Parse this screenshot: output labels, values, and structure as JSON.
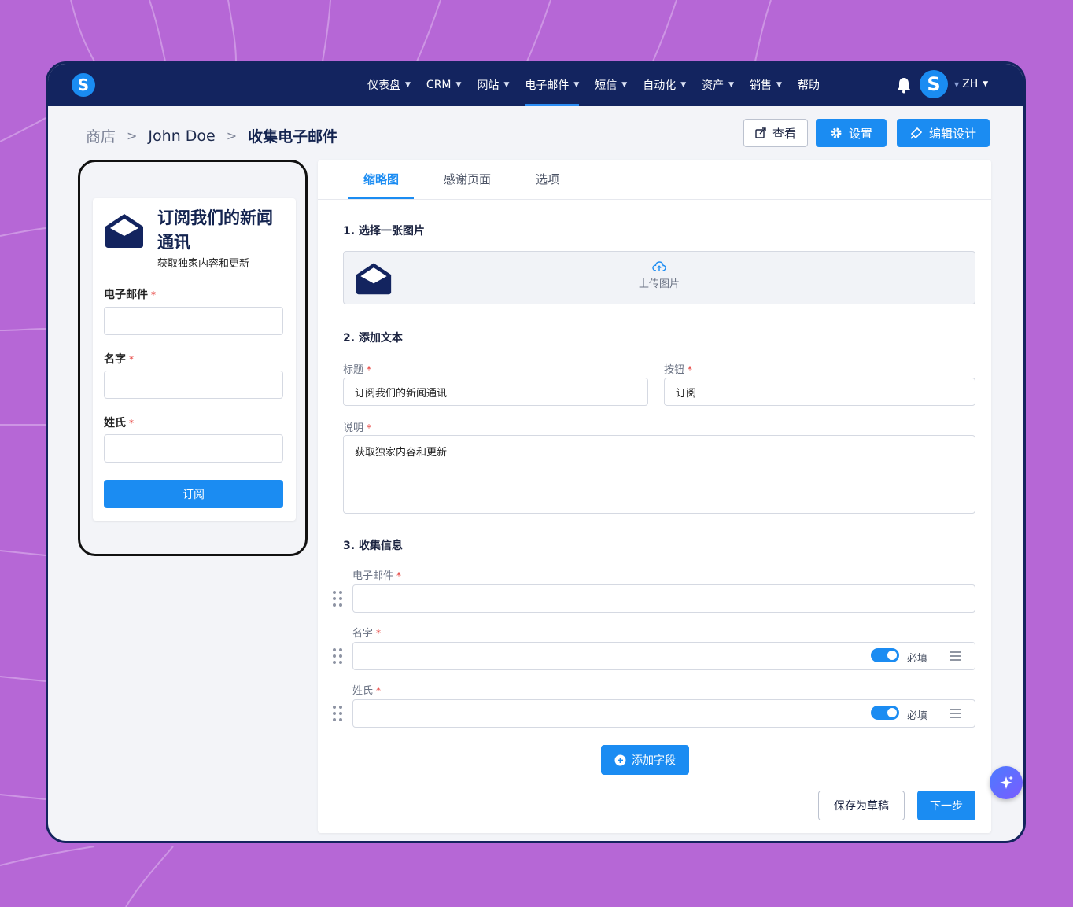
{
  "nav": {
    "items": [
      {
        "label": "仪表盘",
        "has_menu": true
      },
      {
        "label": "CRM",
        "has_menu": true
      },
      {
        "label": "网站",
        "has_menu": true
      },
      {
        "label": "电子邮件",
        "has_menu": true,
        "active": true
      },
      {
        "label": "短信",
        "has_menu": true
      },
      {
        "label": "自动化",
        "has_menu": true
      },
      {
        "label": "资产",
        "has_menu": true
      },
      {
        "label": "销售",
        "has_menu": true
      },
      {
        "label": "帮助",
        "has_menu": false
      }
    ],
    "logo_letter": "S",
    "avatar_letter": "S",
    "language": "ZH"
  },
  "breadcrumb": {
    "store": "商店",
    "user": "John Doe",
    "current": "收集电子邮件"
  },
  "header_buttons": {
    "view": "查看",
    "settings": "设置",
    "edit_design": "编辑设计"
  },
  "preview": {
    "title": "订阅我们的新闻通讯",
    "description": "获取独家内容和更新",
    "fields": [
      "电子邮件",
      "名字",
      "姓氏"
    ],
    "button": "订阅"
  },
  "tabs": [
    "缩略图",
    "感谢页面",
    "选项"
  ],
  "form": {
    "section1": "1. 选择一张图片",
    "upload_label": "上传图片",
    "section2": "2. 添加文本",
    "title_label": "标题",
    "title_value": "订阅我们的新闻通讯",
    "button_label": "按钮",
    "button_value": "订阅",
    "desc_label": "说明",
    "desc_value": "获取独家内容和更新",
    "section3": "3. 收集信息",
    "collect_fields": [
      {
        "label": "电子邮件",
        "required_toggle": false
      },
      {
        "label": "名字",
        "required_toggle": true,
        "required_text": "必填"
      },
      {
        "label": "姓氏",
        "required_toggle": true,
        "required_text": "必填"
      }
    ],
    "add_field": "添加字段",
    "save_draft": "保存为草稿",
    "next": "下一步"
  },
  "colors": {
    "navy": "#13245f",
    "primary": "#1b8cf2",
    "background": "#b667d6"
  }
}
